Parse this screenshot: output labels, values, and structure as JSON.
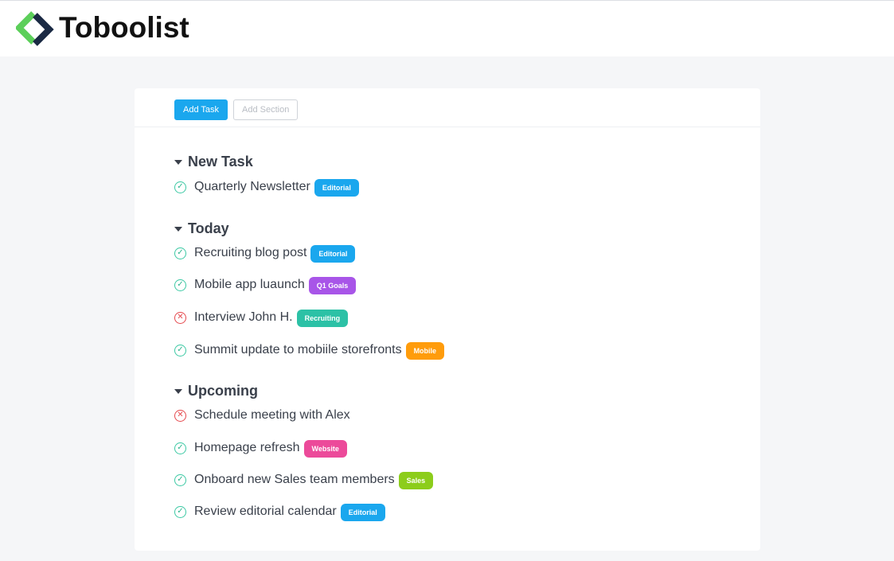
{
  "app": {
    "name": "Toboolist"
  },
  "toolbar": {
    "add_task_label": "Add Task",
    "add_section_label": "Add Section"
  },
  "sections": [
    {
      "title": "New Task",
      "tasks": [
        {
          "title": "Quarterly Newsletter",
          "status": "done",
          "tag": "Editorial",
          "tag_color": "#1aa7ee"
        }
      ]
    },
    {
      "title": "Today",
      "tasks": [
        {
          "title": "Recruiting blog post",
          "status": "done",
          "tag": "Editorial",
          "tag_color": "#1aa7ee"
        },
        {
          "title": "Mobile app luaunch",
          "status": "done",
          "tag": "Q1 Goals",
          "tag_color": "#a855e8"
        },
        {
          "title": "Interview John H.",
          "status": "cancelled",
          "tag": "Recruiting",
          "tag_color": "#2cc1a6"
        },
        {
          "title": "Summit update to mobiile storefronts",
          "status": "done",
          "tag": "Mobile",
          "tag_color": "#ff9c0b"
        }
      ]
    },
    {
      "title": "Upcoming",
      "tasks": [
        {
          "title": "Schedule meeting with Alex",
          "status": "cancelled",
          "tag": "",
          "tag_color": ""
        },
        {
          "title": "Homepage refresh",
          "status": "done",
          "tag": "Website",
          "tag_color": "#ec4a9a"
        },
        {
          "title": "Onboard new Sales team members",
          "status": "done",
          "tag": "Sales",
          "tag_color": "#8ccd1b"
        },
        {
          "title": "Review editorial calendar",
          "status": "done",
          "tag": "Editorial",
          "tag_color": "#1aa7ee"
        }
      ]
    }
  ],
  "colors": {
    "accent": "#1aa7ee",
    "done": "#3cc9a4",
    "cancelled": "#e5484d",
    "logo_green": "#5ccf5a",
    "logo_dark": "#1b2a44"
  }
}
